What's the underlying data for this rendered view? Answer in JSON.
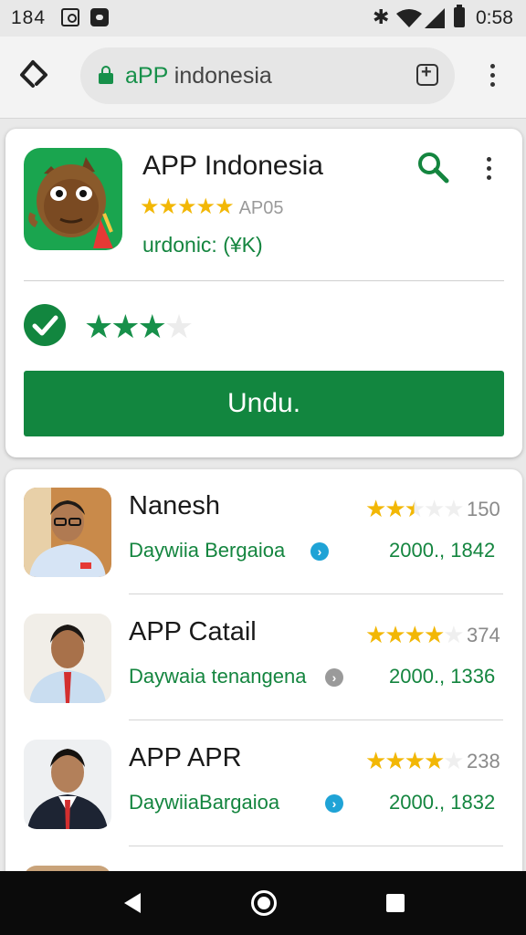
{
  "status_bar": {
    "left_time": "184",
    "clock": "0:58",
    "icons": [
      "image-icon",
      "camera-icon",
      "bluetooth-icon",
      "wifi-icon",
      "signal-icon",
      "battery-icon"
    ]
  },
  "browser": {
    "url_prefix": "aPP",
    "url_suffix": " indonesia",
    "icons": [
      "back-diamond-icon",
      "lock-icon",
      "new-tab-icon",
      "overflow-menu-icon"
    ]
  },
  "app": {
    "title": "APP Indonesia",
    "stars": "★★★★★",
    "rating_code": "AP05",
    "downloads": "urdonic: (¥K)",
    "user_rating": 3,
    "user_rating_max": 4,
    "download_button": "Undu.",
    "colors": {
      "accent": "#12863f",
      "star": "#f2b705"
    }
  },
  "list": [
    {
      "name": "Nanesh",
      "subtitle": "Daywiia Bergaioa",
      "chevron_color": "#1fa3d6",
      "count": "150",
      "meta": "2000., 1842",
      "stars": 2.5
    },
    {
      "name": "APP Catail",
      "subtitle": "Daywaia tenangena",
      "chevron_color": "#9a9a9a",
      "count": "374",
      "meta": "2000., 1336",
      "stars": 4
    },
    {
      "name": "APP APR",
      "subtitle": "DaywiiaBargaioa",
      "chevron_color": "#1fa3d6",
      "count": "238",
      "meta": "2000., 1832",
      "stars": 4
    }
  ],
  "nav_bar": {
    "icons": [
      "back-triangle-icon",
      "home-circle-icon",
      "recents-square-icon"
    ]
  }
}
